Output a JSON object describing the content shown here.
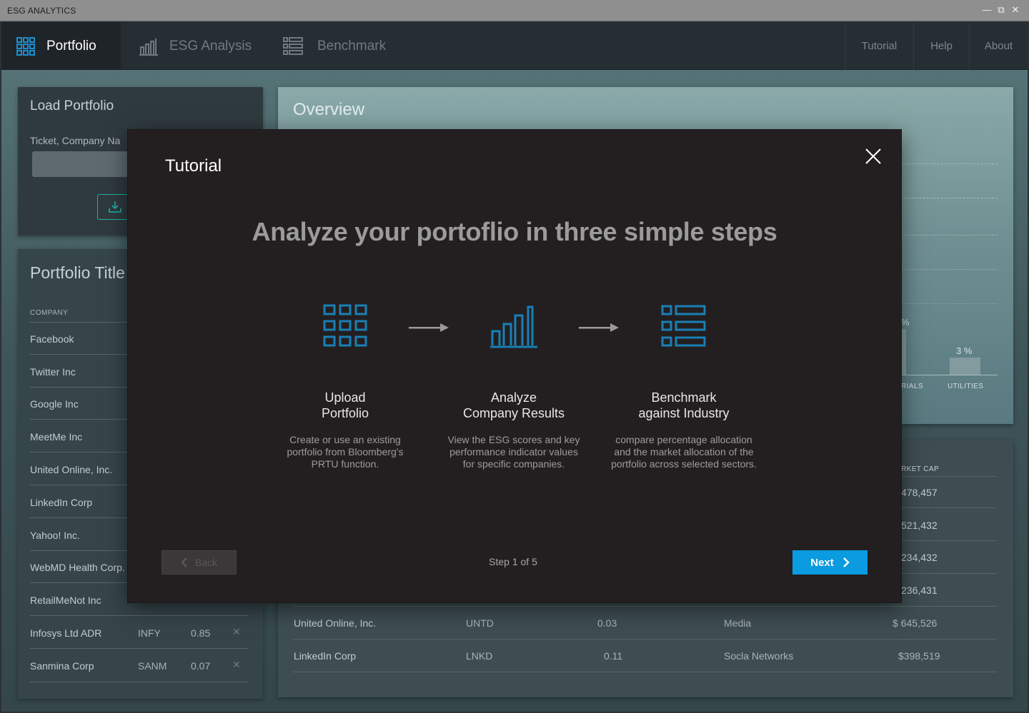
{
  "window": {
    "title": "ESG ANALYTICS"
  },
  "nav": {
    "tabs": [
      {
        "label": "Portfolio",
        "icon": "grid-icon"
      },
      {
        "label": "ESG Analysis",
        "icon": "bar-chart-icon"
      },
      {
        "label": "Benchmark",
        "icon": "list-icon"
      }
    ],
    "right": [
      "Tutorial",
      "Help",
      "About"
    ]
  },
  "load_portfolio": {
    "title": "Load Portfolio",
    "field_label": "Ticket, Company Na"
  },
  "portfolio_list": {
    "title": "Portfolio Title",
    "col_header": "COMPANY",
    "rows": [
      {
        "company": "Facebook"
      },
      {
        "company": "Twitter Inc"
      },
      {
        "company": "Google Inc"
      },
      {
        "company": "MeetMe Inc"
      },
      {
        "company": "United Online, Inc."
      },
      {
        "company": "LinkedIn Corp"
      },
      {
        "company": "Yahoo! Inc."
      },
      {
        "company": "WebMD Health Corp."
      },
      {
        "company": "RetailMeNot Inc"
      },
      {
        "company": "Infosys Ltd ADR",
        "ticker": "INFY",
        "weight": "0.85"
      },
      {
        "company": "Sanmina Corp",
        "ticker": "SANM",
        "weight": "0.07"
      }
    ]
  },
  "overview": {
    "title": "Overview",
    "bars": [
      {
        "label": "RIALS",
        "pct": "%"
      },
      {
        "label": "UTILITIES",
        "pct": "3 %"
      }
    ]
  },
  "holdings_table": {
    "col_header": "RKET CAP",
    "partial_caps": [
      "478,457",
      "521,432",
      "234,432",
      "236,431"
    ],
    "rows": [
      {
        "company": "United Online, Inc.",
        "ticker": "UNTD",
        "weight": "0.03",
        "sector": "Media",
        "cap": "$ 645,526"
      },
      {
        "company": "LinkedIn Corp",
        "ticker": "LNKD",
        "weight": "0.11",
        "sector": "Socla Networks",
        "cap": "$398,519"
      }
    ]
  },
  "tutorial": {
    "title": "Tutorial",
    "headline": "Analyze your portoflio in three simple steps",
    "steps": [
      {
        "title_line1": "Upload",
        "title_line2": "Portfolio",
        "desc": "Create or use an existing portfolio from Bloomberg's PRTU function.",
        "icon": "grid-icon"
      },
      {
        "title_line1": "Analyze",
        "title_line2": "Company Results",
        "desc": "View the ESG scores and key performance indicator values for specific companies.",
        "icon": "bar-chart-icon"
      },
      {
        "title_line1": "Benchmark",
        "title_line2": "against Industry",
        "desc": "compare percentage allocation and the market allocation of the portfolio across selected sectors.",
        "icon": "list-icon"
      }
    ],
    "back_label": "Back",
    "next_label": "Next",
    "step_counter": "Step 1 of 5"
  },
  "colors": {
    "accent": "#0a9be0",
    "icon_blue": "#1a7fb5",
    "modal_bg": "#231f20"
  }
}
